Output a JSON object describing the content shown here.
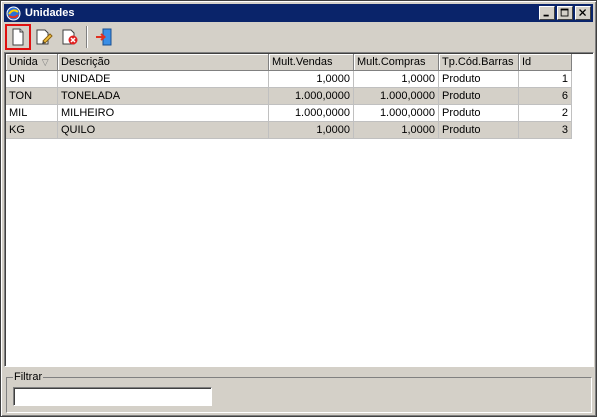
{
  "window": {
    "title": "Unidades"
  },
  "toolbar": {
    "buttons": [
      {
        "name": "new",
        "icon": "new-document-icon"
      },
      {
        "name": "edit",
        "icon": "edit-document-icon"
      },
      {
        "name": "delete",
        "icon": "delete-document-icon"
      },
      {
        "name": "exit",
        "icon": "exit-door-icon"
      }
    ]
  },
  "grid": {
    "columns": [
      "Unida",
      "Descrição",
      "Mult.Vendas",
      "Mult.Compras",
      "Tp.Cód.Barras",
      "Id"
    ],
    "rows": [
      [
        "UN",
        "UNIDADE",
        "1,0000",
        "1,0000",
        "Produto",
        "1"
      ],
      [
        "TON",
        "TONELADA",
        "1.000,0000",
        "1.000,0000",
        "Produto",
        "6"
      ],
      [
        "MIL",
        "MILHEIRO",
        "1.000,0000",
        "1.000,0000",
        "Produto",
        "2"
      ],
      [
        "KG",
        "QUILO",
        "1,0000",
        "1,0000",
        "Produto",
        "3"
      ]
    ]
  },
  "filter": {
    "label": "Filtrar",
    "value": "",
    "placeholder": ""
  },
  "colors": {
    "titlebar": "#0a246a",
    "face": "#d4d0c8",
    "selection_outline": "#e01010"
  }
}
